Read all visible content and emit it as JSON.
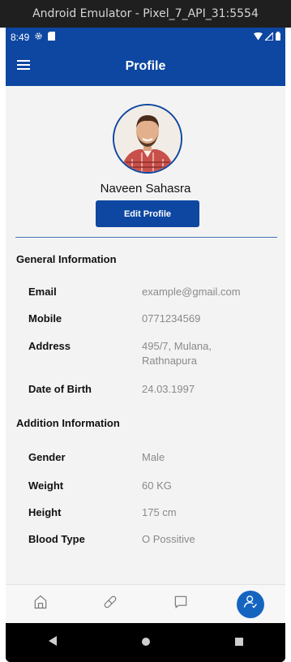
{
  "emulator": {
    "title": "Android Emulator - Pixel_7_API_31:5554"
  },
  "status_bar": {
    "time": "8:49"
  },
  "app_bar": {
    "title": "Profile"
  },
  "profile": {
    "name": "Naveen Sahasra",
    "edit_label": "Edit Profile"
  },
  "general": {
    "title": "General Information",
    "rows": [
      {
        "label": "Email",
        "value": "example@gmail.com"
      },
      {
        "label": "Mobile",
        "value": "0771234569"
      },
      {
        "label": "Address",
        "value": "495/7, Mulana,",
        "value2": "Rathnapura"
      },
      {
        "label": "Date of Birth",
        "value": "24.03.1997"
      }
    ]
  },
  "addition": {
    "title": "Addition Information",
    "rows": [
      {
        "label": "Gender",
        "value": "Male"
      },
      {
        "label": "Weight",
        "value": "60 KG"
      },
      {
        "label": "Height",
        "value": "175 cm"
      },
      {
        "label": "Blood Type",
        "value": "O Possitive"
      }
    ]
  },
  "nav": {
    "items": [
      "home-icon",
      "pill-icon",
      "chat-icon",
      "profile-icon"
    ],
    "active": "profile-icon",
    "accent": "#1565c0"
  },
  "colors": {
    "primary": "#0d47a1",
    "background": "#f3f3f3",
    "value_text": "#8a8a8a"
  }
}
